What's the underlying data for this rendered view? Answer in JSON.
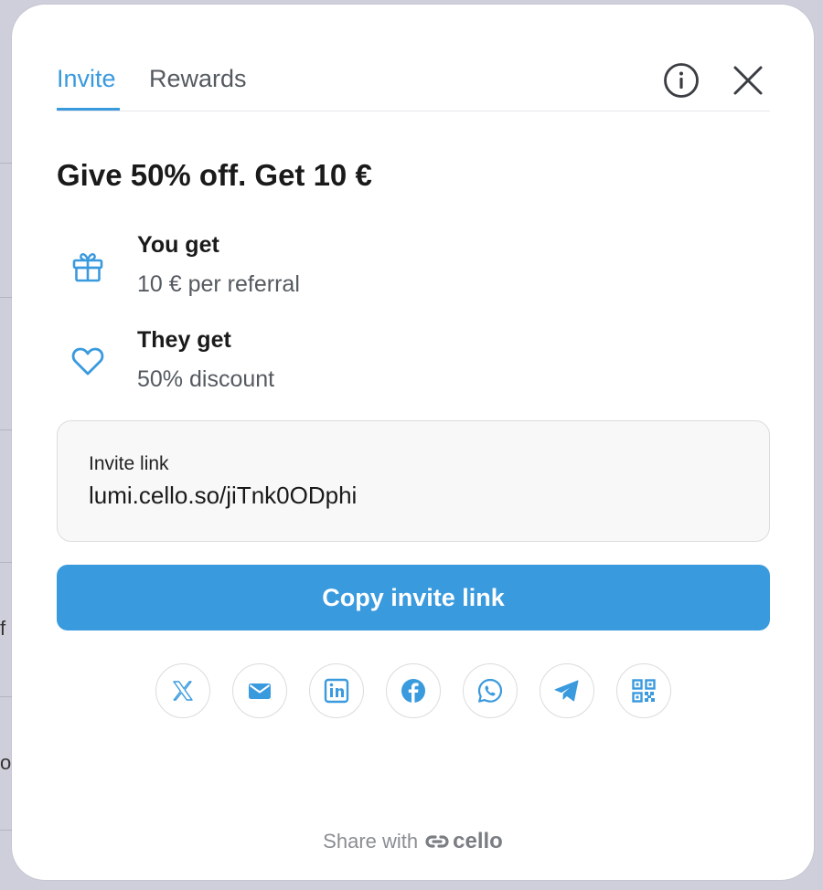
{
  "tabs": [
    {
      "label": "Invite",
      "active": true
    },
    {
      "label": "Rewards",
      "active": false
    }
  ],
  "header_icons": {
    "info": "info-icon",
    "close": "close-icon"
  },
  "headline": "Give 50% off. Get 10 €",
  "benefits": [
    {
      "icon": "gift-icon",
      "title": "You get",
      "subtitle": "10 € per referral"
    },
    {
      "icon": "heart-icon",
      "title": "They get",
      "subtitle": "50% discount"
    }
  ],
  "invite_link": {
    "label": "Invite link",
    "value": "lumi.cello.so/jiTnk0ODphi"
  },
  "copy_button": "Copy invite link",
  "share_icons": [
    "x-icon",
    "email-icon",
    "linkedin-icon",
    "facebook-icon",
    "whatsapp-icon",
    "telegram-icon",
    "qr-code-icon"
  ],
  "footer": {
    "text": "Share with",
    "brand": "cello"
  },
  "background_glyphs": [
    "f",
    "o"
  ],
  "colors": {
    "accent": "#3a9ade",
    "text": "#1a1a1a",
    "muted": "#555a60"
  }
}
